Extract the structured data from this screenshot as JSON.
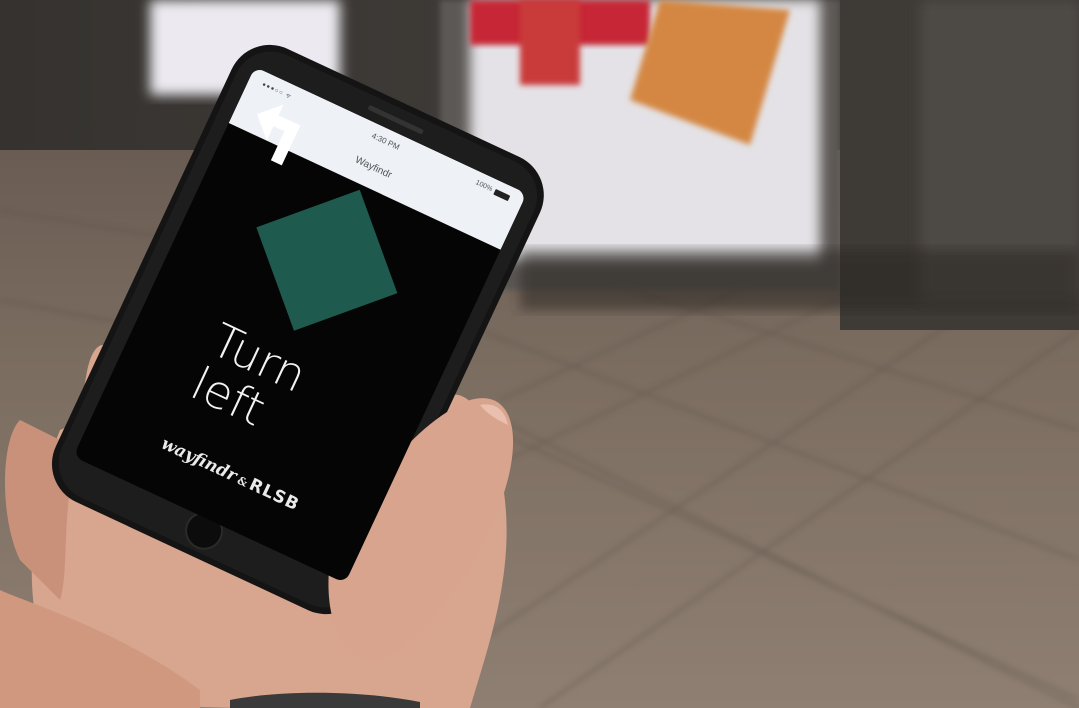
{
  "photo": {
    "colors": {
      "floor": "#7b6c60",
      "wall": "#3e3a36",
      "display_case": "#e4e2e6",
      "poster_orange": "#d48742",
      "poster_red": "#c62836",
      "phone_body": "#141414",
      "skin": "#d8a58f"
    }
  },
  "phone": {
    "status_bar": {
      "signal": "●●●○○ ᯤ",
      "time": "4:30 PM",
      "battery_text": "100%"
    },
    "app_title": "Wayfindr",
    "direction": {
      "icon": "turn-left-arrow-icon",
      "color": "#1f5a4e"
    },
    "instruction": {
      "line1": "Turn",
      "line2": "left"
    },
    "footer": {
      "logo1": "wayfindr",
      "amp": "&",
      "logo2": "RLSB"
    }
  }
}
